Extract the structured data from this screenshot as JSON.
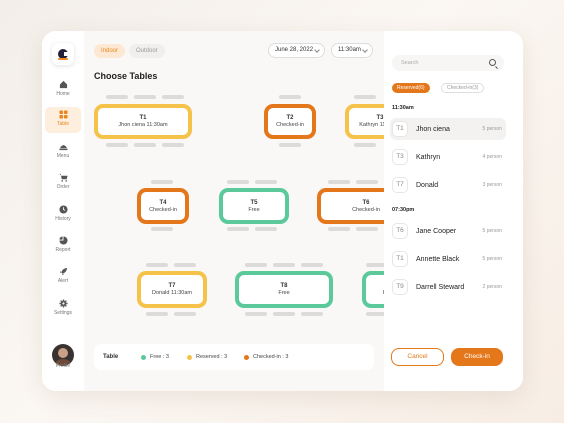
{
  "sidebar": {
    "items": [
      {
        "label": "Home",
        "icon": "home-icon"
      },
      {
        "label": "Table",
        "icon": "table-icon"
      },
      {
        "label": "Menu",
        "icon": "menu-icon"
      },
      {
        "label": "Order",
        "icon": "cart-icon"
      },
      {
        "label": "History",
        "icon": "clock-icon"
      },
      {
        "label": "Report",
        "icon": "pie-chart-icon"
      },
      {
        "label": "Alert",
        "icon": "rocket-icon"
      },
      {
        "label": "Settings",
        "icon": "gear-icon"
      }
    ],
    "profile_label": "Profile"
  },
  "main": {
    "segments": {
      "indoor": "Indoor",
      "outdoor": "Outdoor"
    },
    "date": "June 28, 2022",
    "time": "11:30am",
    "title": "Choose Tables",
    "tables": [
      {
        "id": "T1",
        "status": "Jhon ciena  11:30am"
      },
      {
        "id": "T2",
        "status": "Checked-in"
      },
      {
        "id": "T3",
        "status": "Kathryn 11:30pm"
      },
      {
        "id": "T4",
        "status": "Checked-in"
      },
      {
        "id": "T5",
        "status": "Free"
      },
      {
        "id": "T6",
        "status": "Checked-in"
      },
      {
        "id": "T7",
        "status": "Donald 11:30am"
      },
      {
        "id": "T8",
        "status": "Free"
      },
      {
        "id": "T9",
        "status": "Free"
      }
    ],
    "legend": {
      "title": "Table",
      "free": "Free : 3",
      "reserved": "Reserved : 3",
      "checked": "Checked-in : 3"
    }
  },
  "panel": {
    "search_placeholder": "Search",
    "tabs": {
      "reserved": "Reserved(6)",
      "checked": "Checked-in(3)"
    },
    "groups": [
      {
        "time": "11:30am",
        "rows": [
          {
            "table": "T1",
            "name": "Jhon ciena",
            "persons": "5 person"
          },
          {
            "table": "T3",
            "name": "Kathryn",
            "persons": "4 person"
          },
          {
            "table": "T7",
            "name": "Donald",
            "persons": "3 person"
          }
        ]
      },
      {
        "time": "07:30pm",
        "rows": [
          {
            "table": "T6",
            "name": "Jane Cooper",
            "persons": "5 person"
          },
          {
            "table": "T1",
            "name": "Annette Black",
            "persons": "5 person"
          },
          {
            "table": "T9",
            "name": "Darrell Steward",
            "persons": "2 person"
          }
        ]
      }
    ],
    "cancel": "Cancel",
    "checkin": "Check-in"
  },
  "colors": {
    "accent": "#e4771a",
    "reserved": "#f5c24a",
    "checked_in": "#e4771a",
    "free": "#5cc99a"
  }
}
